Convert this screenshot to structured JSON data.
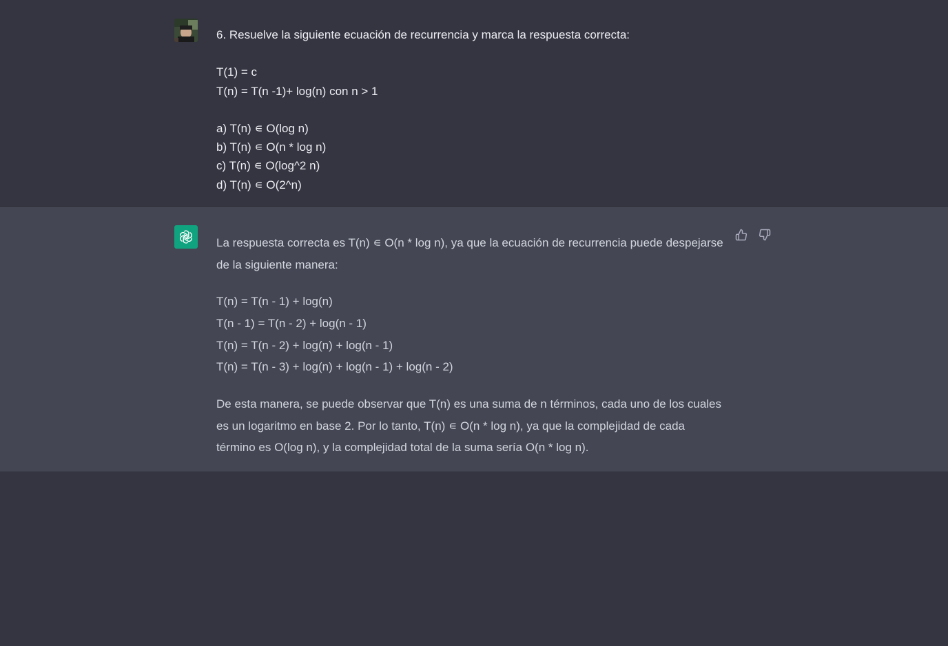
{
  "conversation": {
    "user_message": {
      "avatar_icon": "user-photo-avatar",
      "lines": [
        "6. Resuelve la siguiente ecuación de recurrencia y marca la respuesta correcta:",
        "",
        "T(1) = c",
        "T(n) = T(n -1)+ log(n) con n > 1",
        "",
        "a) T(n) ∊ O(log n)",
        "b) T(n) ∊ O(n * log n)",
        "c) T(n) ∊ O(log^2 n)",
        "d) T(n) ∊ O(2^n)"
      ]
    },
    "assistant_message": {
      "avatar_icon": "openai-logo-icon",
      "intro": "La respuesta correcta es T(n) ∊ O(n * log n), ya que la ecuación de recurrencia puede despejarse de la siguiente manera:",
      "equations": [
        "T(n) = T(n - 1) + log(n)",
        "T(n - 1) = T(n - 2) + log(n - 1)",
        "T(n) = T(n - 2) + log(n) + log(n - 1)",
        "T(n) = T(n - 3) + log(n) + log(n - 1) + log(n - 2)"
      ],
      "conclusion": "De esta manera, se puede observar que T(n) es una suma de n términos, cada uno de los cuales es un logaritmo en base 2. Por lo tanto, T(n) ∊ O(n * log n), ya que la complejidad de cada término es O(log n), y la complejidad total de la suma sería O(n * log n).",
      "feedback": {
        "thumbs_up_icon": "thumbs-up-icon",
        "thumbs_down_icon": "thumbs-down-icon"
      }
    }
  },
  "colors": {
    "background": "#343541",
    "assistant_background": "#444654",
    "user_text": "#ececf1",
    "assistant_text": "#d1d5db",
    "brand_green": "#10a37f",
    "icon_gray": "#acacbe"
  }
}
